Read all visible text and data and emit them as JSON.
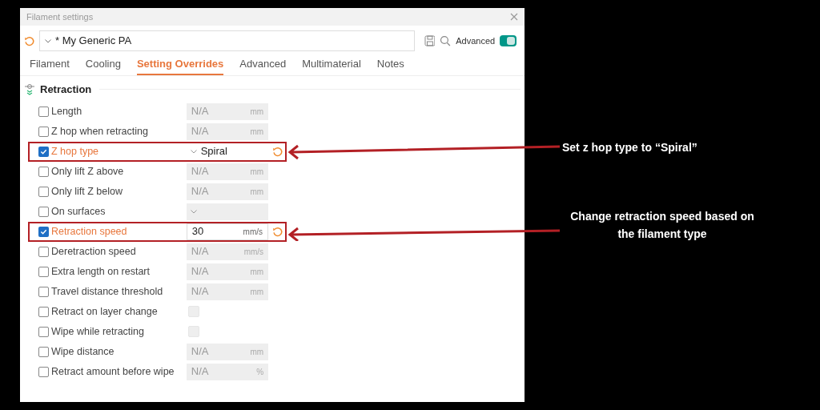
{
  "window": {
    "title": "Filament settings"
  },
  "preset": {
    "value": "* My Generic PA",
    "advanced_label": "Advanced",
    "advanced_on": true
  },
  "tabs": [
    {
      "label": "Filament",
      "selected": false
    },
    {
      "label": "Cooling",
      "selected": false
    },
    {
      "label": "Setting Overrides",
      "selected": true
    },
    {
      "label": "Advanced",
      "selected": false
    },
    {
      "label": "Multimaterial",
      "selected": false
    },
    {
      "label": "Notes",
      "selected": false
    }
  ],
  "section": {
    "title": "Retraction"
  },
  "rows": [
    {
      "kind": "field",
      "label": "Length",
      "checked": false,
      "value": "N/A",
      "unit": "mm",
      "highlighted": false
    },
    {
      "kind": "field",
      "label": "Z hop when retracting",
      "checked": false,
      "value": "N/A",
      "unit": "mm",
      "highlighted": false
    },
    {
      "kind": "dropdown",
      "label": "Z hop type",
      "checked": true,
      "value": "Spiral",
      "highlighted": true
    },
    {
      "kind": "field",
      "label": "Only lift Z above",
      "checked": false,
      "value": "N/A",
      "unit": "mm",
      "highlighted": false
    },
    {
      "kind": "field",
      "label": "Only lift Z below",
      "checked": false,
      "value": "N/A",
      "unit": "mm",
      "highlighted": false
    },
    {
      "kind": "dropdown",
      "label": "On surfaces",
      "checked": false,
      "highlighted": false
    },
    {
      "kind": "field",
      "label": "Retraction speed",
      "checked": true,
      "value": "30",
      "unit": "mm/s",
      "highlighted": true
    },
    {
      "kind": "field",
      "label": "Deretraction speed",
      "checked": false,
      "value": "N/A",
      "unit": "mm/s",
      "highlighted": false
    },
    {
      "kind": "field",
      "label": "Extra length on restart",
      "checked": false,
      "value": "N/A",
      "unit": "mm",
      "highlighted": false
    },
    {
      "kind": "field",
      "label": "Travel distance threshold",
      "checked": false,
      "value": "N/A",
      "unit": "mm",
      "highlighted": false
    },
    {
      "kind": "checkbox",
      "label": "Retract on layer change",
      "checked": false,
      "value_checked": false,
      "highlighted": false
    },
    {
      "kind": "checkbox",
      "label": "Wipe while retracting",
      "checked": false,
      "value_checked": false,
      "highlighted": false
    },
    {
      "kind": "field",
      "label": "Wipe distance",
      "checked": false,
      "value": "N/A",
      "unit": "mm",
      "highlighted": false
    },
    {
      "kind": "field",
      "label": "Retract amount before wipe",
      "checked": false,
      "value": "N/A",
      "unit": "%",
      "highlighted": false
    }
  ],
  "callouts": [
    {
      "text": "Set z hop type to “Spiral”"
    },
    {
      "text": "Change retraction speed based on the filament type"
    }
  ]
}
